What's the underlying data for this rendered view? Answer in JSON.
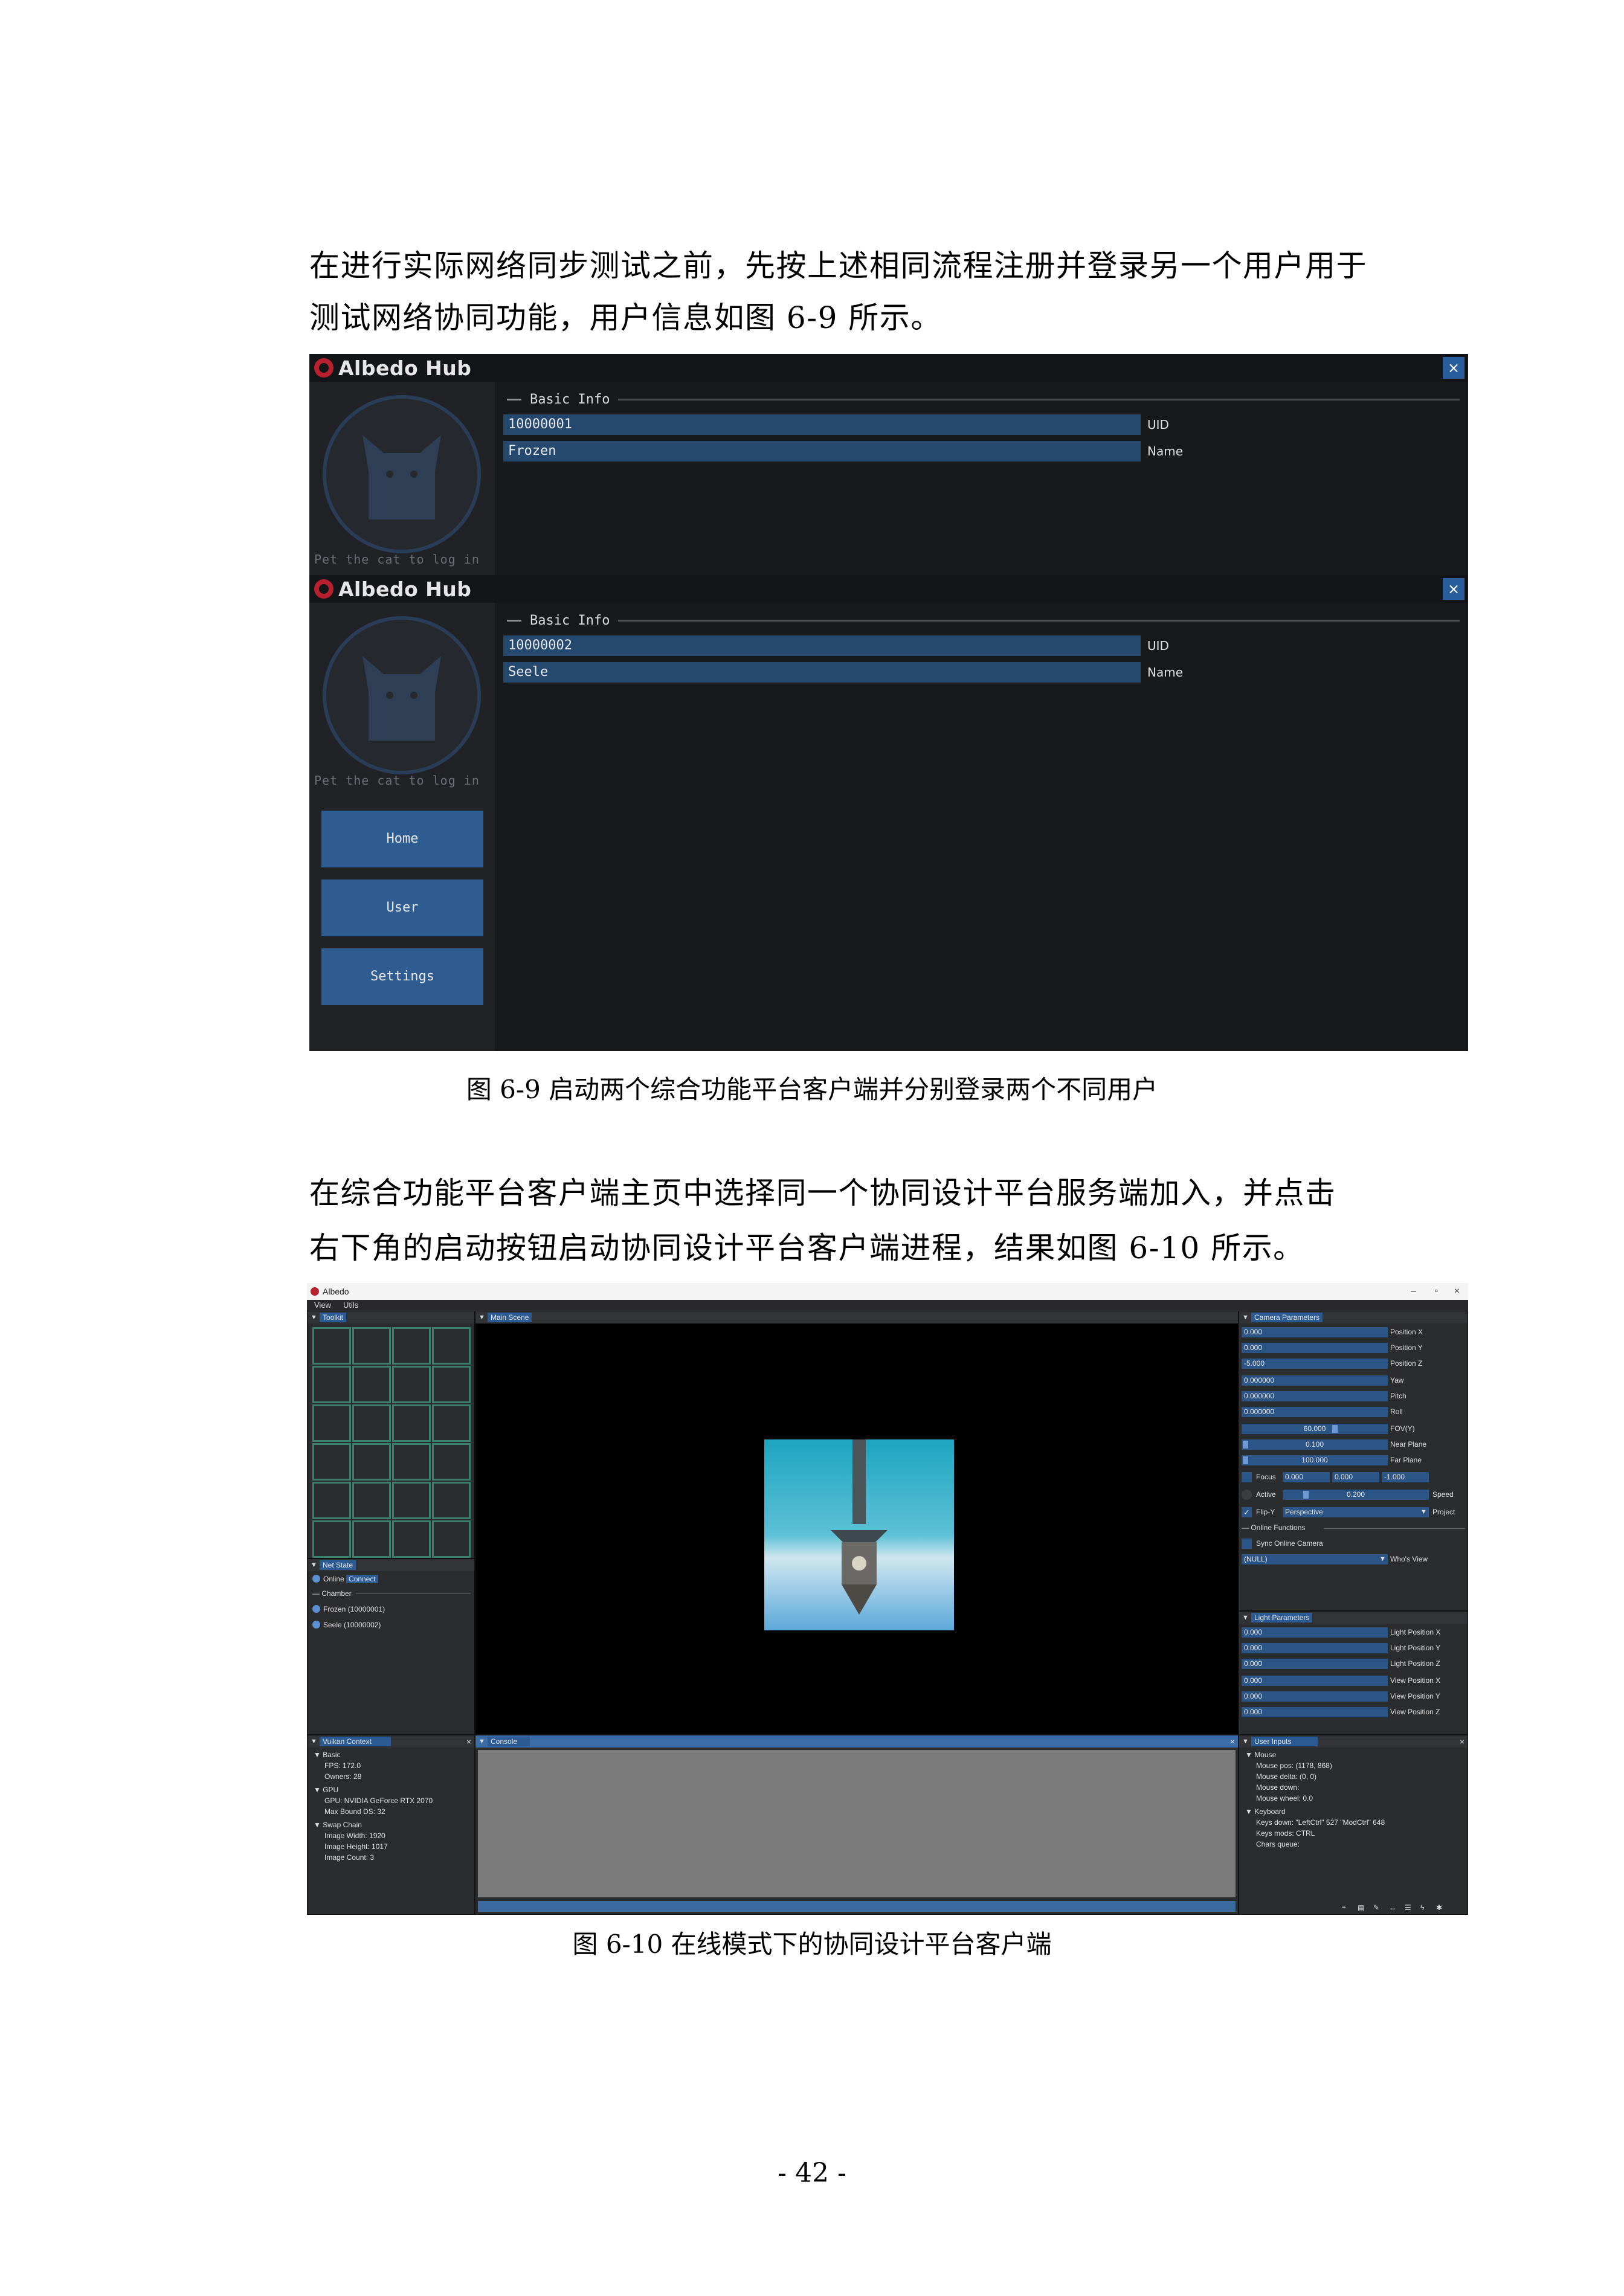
{
  "paragraph1": {
    "line1": "在进行实际网络同步测试之前，先按上述相同流程注册并登录另一个用户用于",
    "line2": "测试网络协同功能，用户信息如图 6-9 所示。"
  },
  "hub_windows": [
    {
      "logo_text": "Albedo Hub",
      "close_label": "×",
      "pet_text": "Pet the cat to log in",
      "section_label": "Basic Info",
      "uid_value": "10000001",
      "uid_label": "UID",
      "name_value": "Frozen",
      "name_label": "Name"
    },
    {
      "logo_text": "Albedo Hub",
      "close_label": "×",
      "pet_text": "Pet the cat to log in",
      "section_label": "Basic Info",
      "uid_value": "10000002",
      "uid_label": "UID",
      "name_value": "Seele",
      "name_label": "Name",
      "nav": [
        "Home",
        "User",
        "Settings"
      ]
    }
  ],
  "caption1": "图 6-9  启动两个综合功能平台客户端并分别登录两个不同用户",
  "paragraph2": {
    "line1": "在综合功能平台客户端主页中选择同一个协同设计平台服务端加入，并点击",
    "line2": "右下角的启动按钮启动协同设计平台客户端进程，结果如图 6-10 所示。"
  },
  "albedo": {
    "title": "Albedo",
    "window_controls": [
      "–",
      "▫",
      "×"
    ],
    "menu": [
      "View",
      "Utils"
    ],
    "toolkit": {
      "tab": "Toolkit"
    },
    "net_state": {
      "tab": "Net State",
      "online": "Online",
      "connect": "Connect",
      "chamber": "Chamber",
      "users": [
        "Frozen (10000001)",
        "Seele (10000002)"
      ]
    },
    "main_scene": {
      "tab": "Main Scene"
    },
    "camera": {
      "tab": "Camera Parameters",
      "position_x": "0.000",
      "position_x_label": "Position X",
      "position_y": "0.000",
      "position_y_label": "Position Y",
      "position_z": "-5.000",
      "position_z_label": "Position Z",
      "yaw": "0.000000",
      "yaw_label": "Yaw",
      "pitch": "0.000000",
      "pitch_label": "Pitch",
      "roll": "0.000000",
      "roll_label": "Roll",
      "fov": "60.000",
      "fov_label": "FOV(Y)",
      "near": "0.100",
      "near_label": "Near Plane",
      "far": "100.000",
      "far_label": "Far Plane",
      "focus_label": "Focus",
      "focus1": "0.000",
      "focus2": "0.000",
      "focus3": "-1.000",
      "active_label": "Active",
      "speed": "0.200",
      "speed_label": "Speed",
      "flip_label": "Flip-Y",
      "projection": "Perspective",
      "projection_label": "Project",
      "online_functions": "Online Functions",
      "sync_label": "Sync Online Camera",
      "view_value": "(NULL)",
      "view_label": "Who's View"
    },
    "light": {
      "tab": "Light Parameters",
      "rows": [
        {
          "value": "0.000",
          "label": "Light Position X"
        },
        {
          "value": "0.000",
          "label": "Light Position Y"
        },
        {
          "value": "0.000",
          "label": "Light Position Z"
        },
        {
          "value": "0.000",
          "label": "View Position X"
        },
        {
          "value": "0.000",
          "label": "View Position Y"
        },
        {
          "value": "0.000",
          "label": "View Position Z"
        }
      ]
    },
    "vulkan": {
      "tab": "Vulkan Context",
      "basic": "Basic",
      "fps": "FPS: 172.0",
      "owners": "Owners: 28",
      "gpu": "GPU",
      "gpu_name": "GPU: NVIDIA GeForce RTX 2070",
      "max_bound": "Max Bound DS: 32",
      "swap": "Swap Chain",
      "width": "Image Width:    1920",
      "height": "Image Height:   1017",
      "count": "Image Count:   3"
    },
    "console": {
      "tab": "Console"
    },
    "inputs": {
      "tab": "User Inputs",
      "mouse": "Mouse",
      "mouse_pos": "Mouse pos: (1178, 868)",
      "mouse_delta": "Mouse delta: (0, 0)",
      "mouse_down": "Mouse down:",
      "mouse_wheel": "Mouse wheel: 0.0",
      "keyboard": "Keyboard",
      "keys_down": "Keys down:  \"LeftCtrl\" 527  \"ModCtrl\" 648",
      "keys_mods": "Keys mods: CTRL",
      "chars": "Chars queue:"
    },
    "colors": {
      "accent": "#2c5a93",
      "grid": "#3b7f6d",
      "sky": "#3ab0c8"
    }
  },
  "caption2": "图 6-10  在线模式下的协同设计平台客户端",
  "page_number": "- 42 -"
}
